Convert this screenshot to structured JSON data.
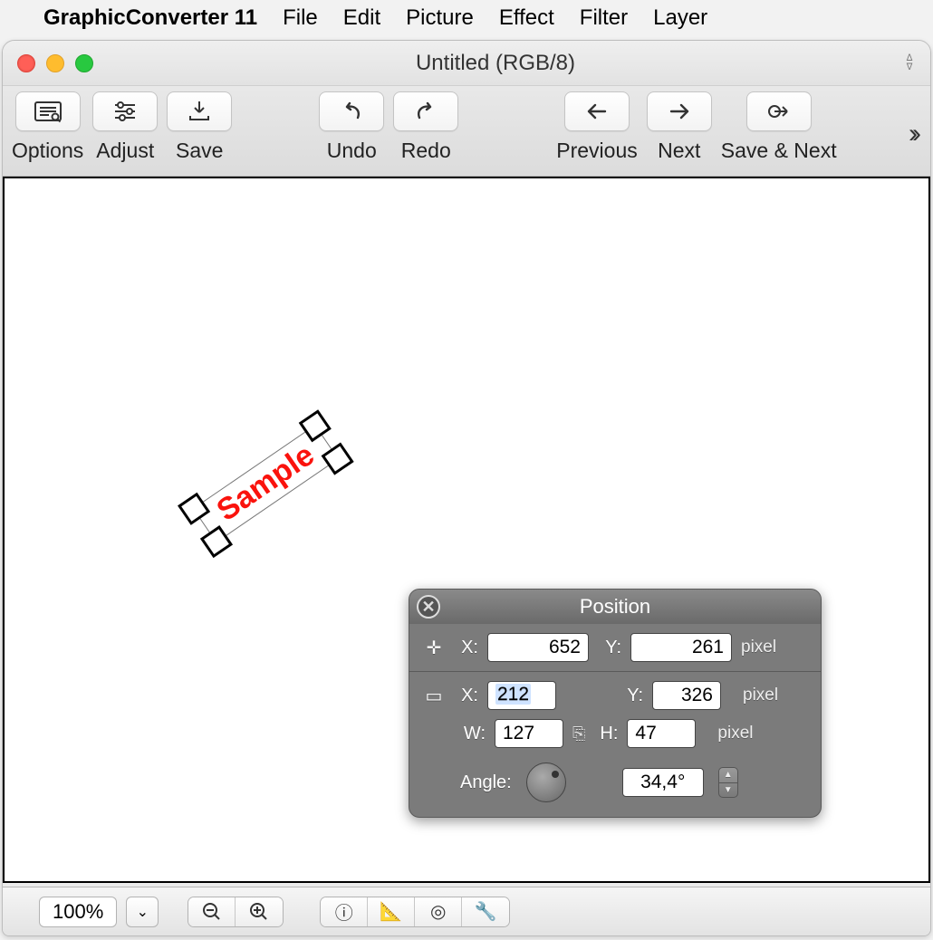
{
  "menubar": {
    "apple": "",
    "app_name": "GraphicConverter 11",
    "items": [
      "File",
      "Edit",
      "Picture",
      "Effect",
      "Filter",
      "Layer"
    ]
  },
  "window": {
    "title": "Untitled (RGB/8)"
  },
  "toolbar": {
    "options": "Options",
    "adjust": "Adjust",
    "save": "Save",
    "undo": "Undo",
    "redo": "Redo",
    "previous": "Previous",
    "next": "Next",
    "save_next": "Save & Next"
  },
  "canvas": {
    "sample_text": "Sample",
    "sample_color": "#fa130d",
    "rotation_deg": -34.4
  },
  "panel": {
    "title": "Position",
    "cursor": {
      "x_label": "X:",
      "x": "652",
      "y_label": "Y:",
      "y": "261",
      "unit": "pixel"
    },
    "sel": {
      "x_label": "X:",
      "x": "212",
      "y_label": "Y:",
      "y": "326",
      "unit": "pixel",
      "w_label": "W:",
      "w": "127",
      "h_label": "H:",
      "h": "47",
      "unit2": "pixel"
    },
    "angle": {
      "label": "Angle:",
      "value": "34,4°"
    }
  },
  "bottombar": {
    "zoom": "100%"
  }
}
